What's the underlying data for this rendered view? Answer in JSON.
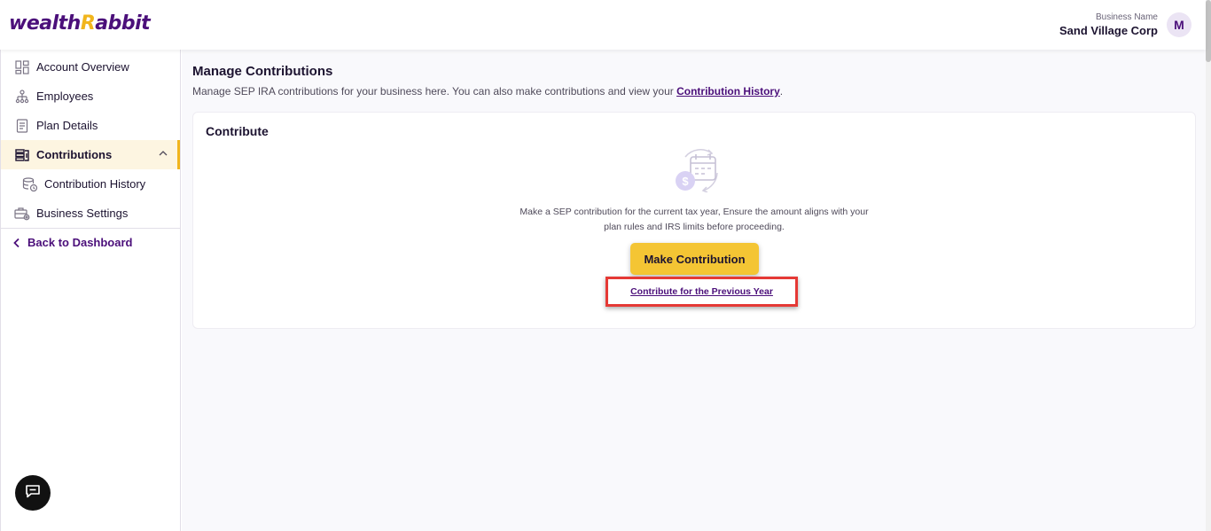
{
  "header": {
    "logo_part1": "wealth",
    "logo_r": "R",
    "logo_part2": "abbit",
    "business_label": "Business Name",
    "business_name": "Sand Village Corp",
    "avatar_initial": "M"
  },
  "sidebar": {
    "items": [
      {
        "label": "Account Overview",
        "icon": "grid-icon"
      },
      {
        "label": "Employees",
        "icon": "org-chart-icon"
      },
      {
        "label": "Plan Details",
        "icon": "document-icon"
      },
      {
        "label": "Contributions",
        "icon": "money-stack-icon"
      },
      {
        "label": "Contribution History",
        "icon": "database-clock-icon"
      },
      {
        "label": "Business Settings",
        "icon": "briefcase-gear-icon"
      }
    ],
    "back_label": "Back to Dashboard"
  },
  "main": {
    "title": "Manage Contributions",
    "desc_prefix": "Manage SEP IRA contributions for your business here. You can also make contributions and view your ",
    "desc_link": "Contribution History",
    "desc_suffix": ".",
    "card": {
      "title": "Contribute",
      "message_line1": "Make a SEP contribution for the current tax year, Ensure the amount aligns with your",
      "message_line2": "plan rules and IRS limits before proceeding.",
      "make_button": "Make Contribution",
      "prev_link": "Contribute for the Previous Year"
    }
  },
  "colors": {
    "brand_purple": "#4b0f7a",
    "brand_yellow": "#f4c534",
    "highlight_red": "#e53935"
  }
}
